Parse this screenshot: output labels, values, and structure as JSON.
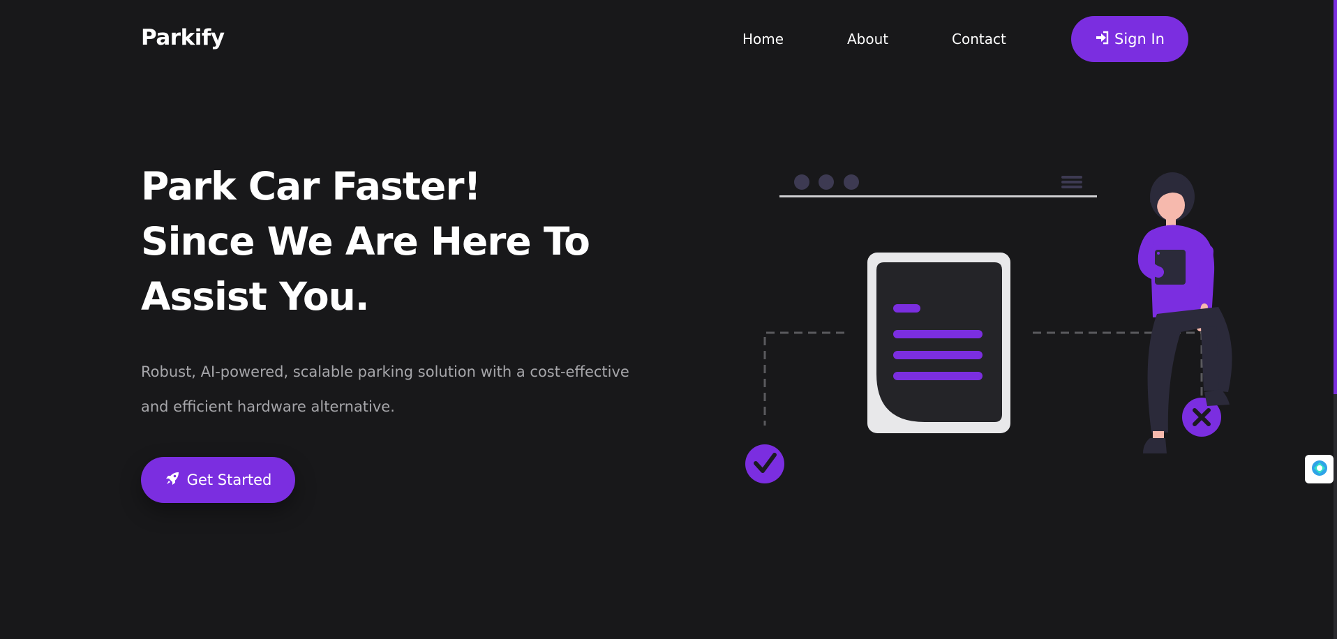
{
  "header": {
    "logo": "Parkify",
    "nav": {
      "home": "Home",
      "about": "About",
      "contact": "Contact"
    },
    "signin_label": "Sign In",
    "signin_icon": "sign-in-icon"
  },
  "hero": {
    "title_lines": [
      "Park Car Faster!",
      "Since We Are Here To",
      "Assist You."
    ],
    "description_lines": [
      "Robust, AI-powered, scalable parking solution with a cost-effective",
      "and efficient hardware alternative."
    ],
    "cta_label": "Get Started",
    "cta_icon": "rocket-icon"
  },
  "colors": {
    "background": "#18181a",
    "accent": "#7b2ee0",
    "text": "#ffffff",
    "muted_text": "#a6a6aa"
  }
}
